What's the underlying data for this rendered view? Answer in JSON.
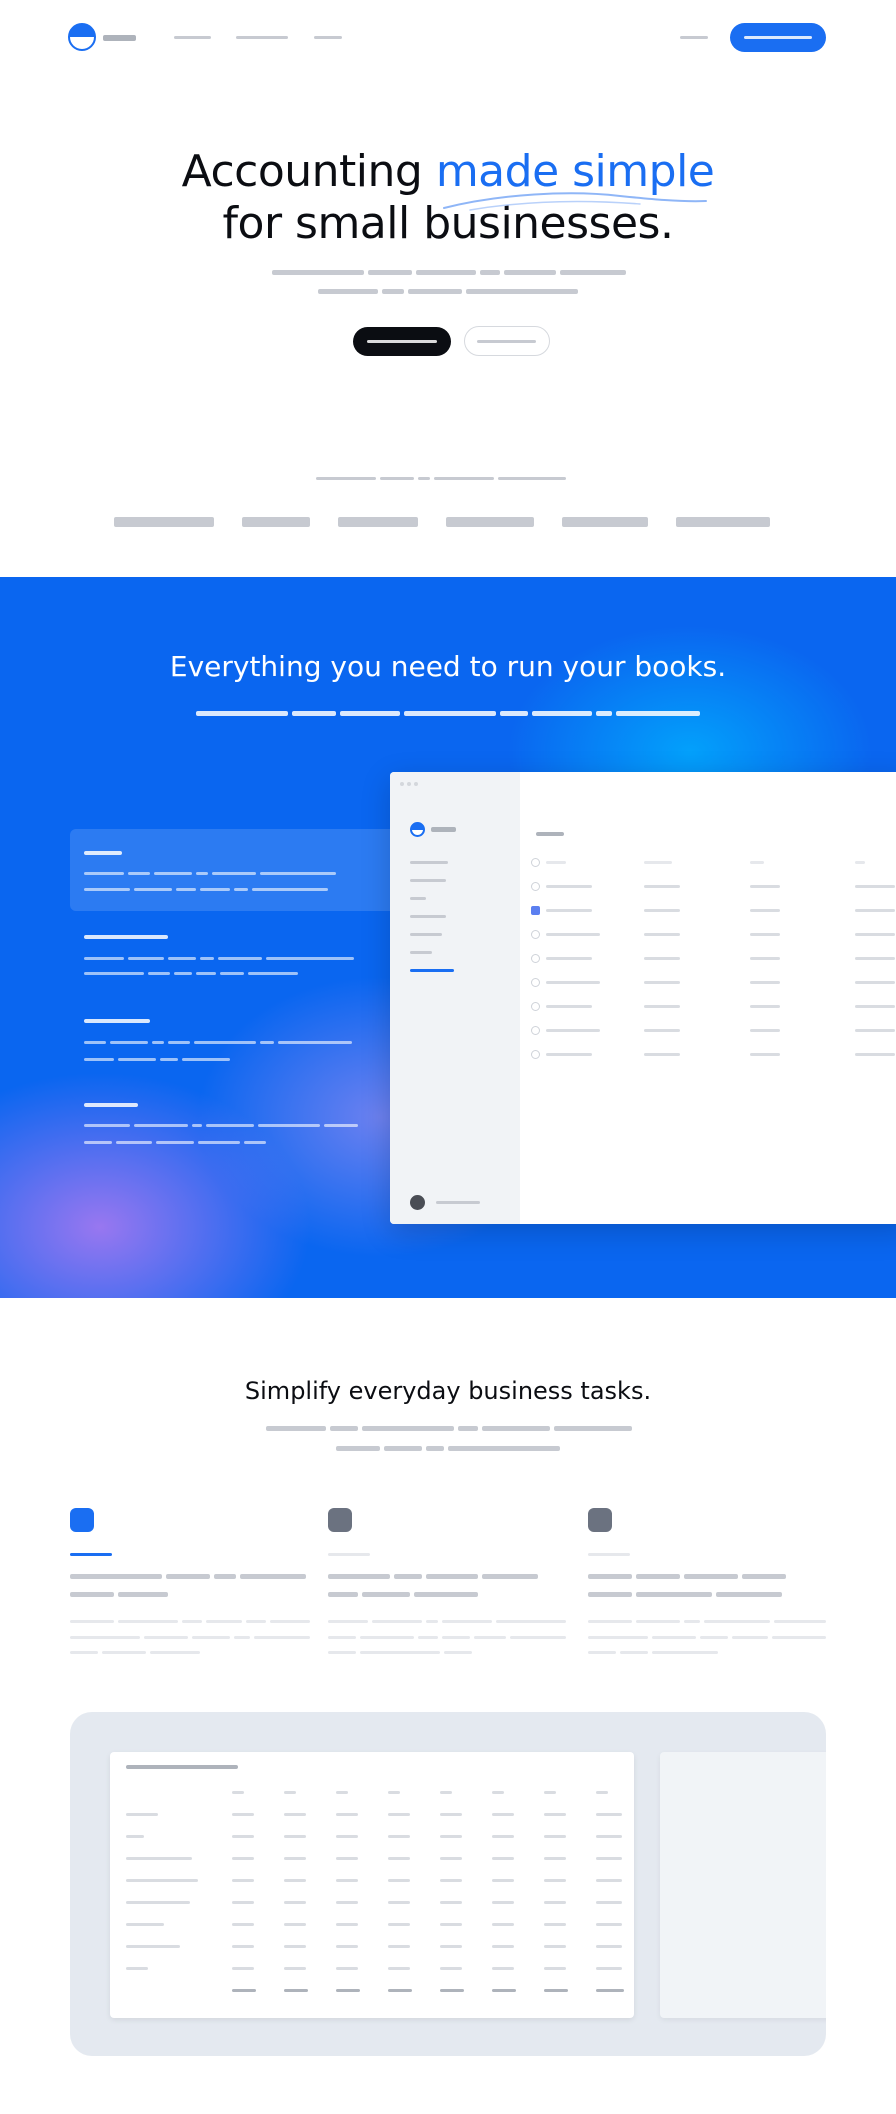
{
  "hero": {
    "title_line1_plain": "Accounting ",
    "title_line1_highlight": "made simple",
    "title_line2": "for small businesses."
  },
  "features_section": {
    "title": "Everything you need to run your books."
  },
  "tasks_section": {
    "title": "Simplify everyday business tasks."
  },
  "colors": {
    "accent": "#1a6ef2",
    "dark": "#0b0d12",
    "section_blue": "#0a66f0",
    "panel_bg": "#e4e9f0"
  },
  "icons": [
    "logo-icon",
    "checkbox-icon",
    "avatar-icon",
    "feature-icon"
  ]
}
